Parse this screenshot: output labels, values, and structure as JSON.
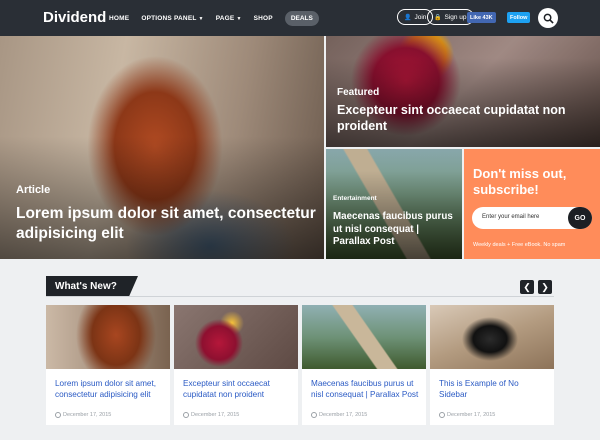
{
  "nav": {
    "logo": "Dividend",
    "menu": [
      {
        "label": "HOME",
        "caret": false
      },
      {
        "label": "OPTIONS PANEL",
        "caret": true
      },
      {
        "label": "PAGE",
        "caret": true
      },
      {
        "label": "SHOP",
        "caret": false
      }
    ],
    "deals_label": "DEALS",
    "join_label": "Join",
    "signup_label": "Sign up",
    "facebook_label": "Like 43K",
    "twitter_label": "Follow"
  },
  "hero": {
    "main": {
      "category": "Article",
      "title": "Lorem ipsum dolor sit amet, consectetur adipisicing elit"
    },
    "featured": {
      "category": "Featured",
      "title": "Excepteur sint occaecat cupidatat non proident"
    },
    "entertainment": {
      "category": "Entertainment",
      "title": "Maecenas faucibus purus ut nisl consequat | Parallax Post"
    },
    "subscribe": {
      "title": "Don't miss out, subscribe!",
      "placeholder": "Enter your email here",
      "button": "GO",
      "note": "Weekly deals + Free eBook. No spam"
    }
  },
  "whats_new": {
    "heading": "What's New?",
    "cards": [
      {
        "title": "Lorem ipsum dolor sit amet, consectetur adipisicing elit",
        "date": "December 17, 2015"
      },
      {
        "title": "Excepteur sint occaecat cupidatat non proident",
        "date": "December 17, 2015"
      },
      {
        "title": "Maecenas faucibus purus ut nisl consequat | Parallax Post",
        "date": "December 17, 2015"
      },
      {
        "title": "This is Example of No Sidebar",
        "date": "December 17, 2015"
      }
    ]
  },
  "colors": {
    "nav_bg": "#2a2f36",
    "subscribe_bg": "#ff8c5a",
    "link_blue": "#2a5ac4"
  }
}
